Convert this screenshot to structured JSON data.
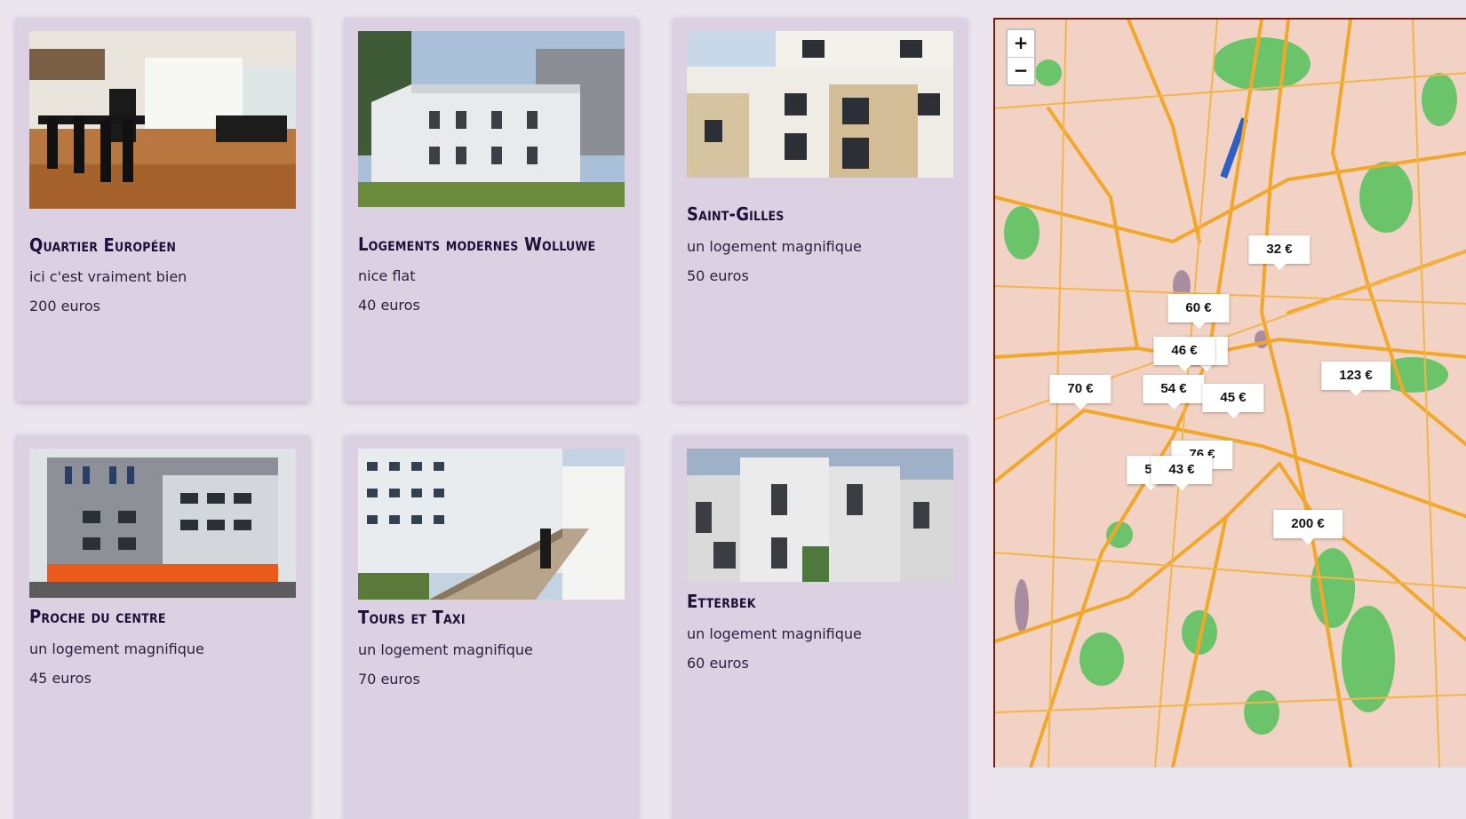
{
  "listings": [
    {
      "title": "Quartier Européen",
      "description": "ici c'est vraiment bien",
      "price": "200 euros",
      "image": "living-room-photo"
    },
    {
      "title": "Logements modernes Wolluwe",
      "description": "nice flat",
      "price": "40 euros",
      "image": "white-building-photo"
    },
    {
      "title": "Saint-Gilles",
      "description": "un logement magnifique",
      "price": "50 euros",
      "image": "beige-building-photo"
    },
    {
      "title": "Proche du centre",
      "description": "un logement magnifique",
      "price": "45 euros",
      "image": "orange-facade-photo"
    },
    {
      "title": "Tours et Taxi",
      "description": "un logement magnifique",
      "price": "70 euros",
      "image": "walkway-building-photo"
    },
    {
      "title": "Etterbek",
      "description": "un logement magnifique",
      "price": "60 euros",
      "image": "cubic-houses-photo"
    }
  ],
  "map": {
    "zoom_in": "+",
    "zoom_out": "−",
    "markers": [
      "32 €",
      "60 €",
      "€",
      "46 €",
      "123 €",
      "70 €",
      "54 €",
      "45 €",
      "76 €",
      "5(",
      "43 €",
      "200 €"
    ]
  }
}
